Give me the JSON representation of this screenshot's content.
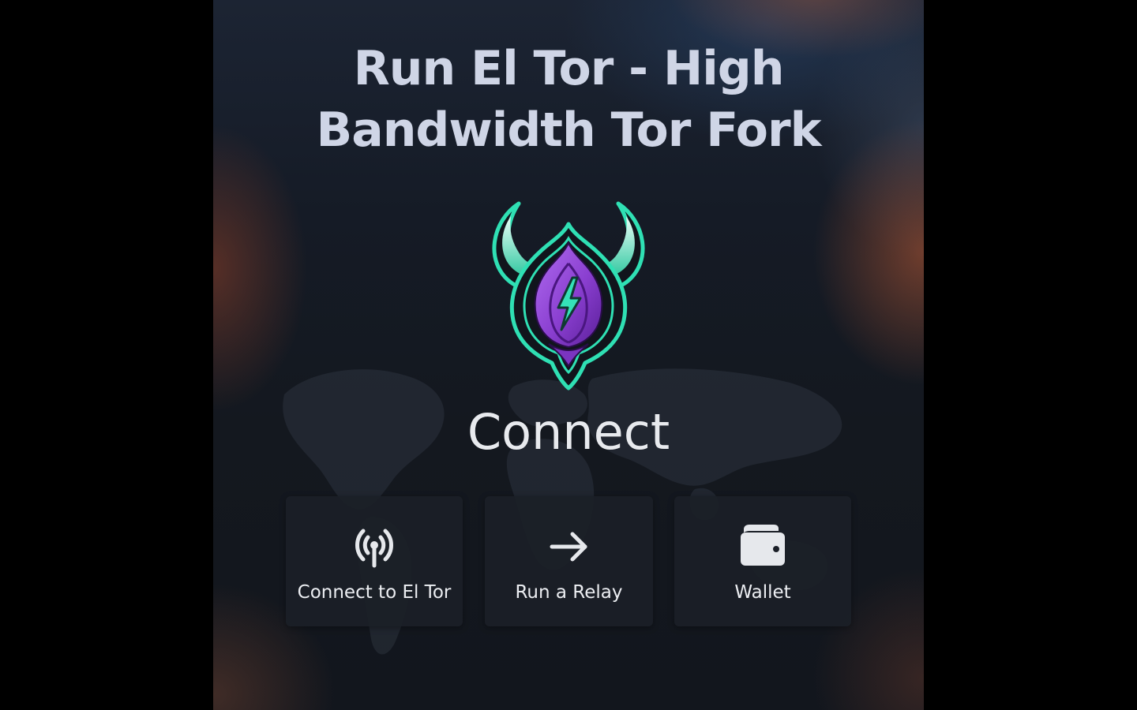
{
  "header": {
    "title_line1": "Run El Tor - High",
    "title_line2": "Bandwidth Tor Fork"
  },
  "logo": {
    "icon": "el-tor-onion-horns-lightning-logo",
    "colors": {
      "outline": "#2fe0b4",
      "onion": "#8a3fd0",
      "onion_dark": "#5a1f99",
      "bolt": "#35e2b8"
    }
  },
  "main": {
    "section_title": "Connect",
    "actions": [
      {
        "label": "Connect to El Tor",
        "icon": "antenna-signal-icon"
      },
      {
        "label": "Run a Relay",
        "icon": "arrow-right-icon"
      },
      {
        "label": "Wallet",
        "icon": "wallet-icon"
      }
    ]
  },
  "theme": {
    "background": "#14181f",
    "card_background": "#1b1f27",
    "text": "#eceef2",
    "title_text": "#cfd5e6"
  }
}
